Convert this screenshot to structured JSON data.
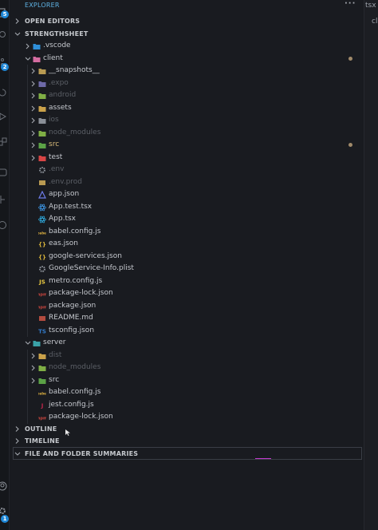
{
  "colors": {
    "background": "#191b20",
    "text": "#c5c8ce",
    "dim_text": "#5b5f66",
    "modified_dot": "#a08a6a",
    "error_dot": "#e0443e",
    "badge": "#1f88d8"
  },
  "activity_bar": {
    "badges": [
      "5",
      "2",
      "1"
    ]
  },
  "right_strip": {
    "tab_fragment": "tsx",
    "title_fragment": "cli"
  },
  "explorer": {
    "title": "EXPLORER",
    "more_icon": "ellipsis-icon"
  },
  "sections": {
    "open_editors": "OPEN EDITORS",
    "project": "STRENGTHSHEET",
    "outline": "OUTLINE",
    "timeline": "TIMELINE",
    "summaries": "FILE AND FOLDER SUMMARIES"
  },
  "tree": [
    {
      "name": ".vscode",
      "icon": "vscode-folder-icon",
      "depth": 0,
      "type": "folder",
      "dim": false
    },
    {
      "name": "client",
      "icon": "client-folder-icon",
      "depth": 0,
      "type": "folder",
      "expanded": true,
      "dim": false,
      "modified": true
    },
    {
      "name": "__snapshots__",
      "icon": "folder-icon",
      "depth": 1,
      "type": "folder",
      "dim": false
    },
    {
      "name": ".expo",
      "icon": "expo-folder-icon",
      "depth": 1,
      "type": "folder",
      "dim": true
    },
    {
      "name": "android",
      "icon": "android-folder-icon",
      "depth": 1,
      "type": "folder",
      "dim": true
    },
    {
      "name": "assets",
      "icon": "assets-folder-icon",
      "depth": 1,
      "type": "folder",
      "dim": false
    },
    {
      "name": "ios",
      "icon": "ios-folder-icon",
      "depth": 1,
      "type": "folder",
      "dim": true
    },
    {
      "name": "node_modules",
      "icon": "node-modules-folder-icon",
      "depth": 1,
      "type": "folder",
      "dim": true
    },
    {
      "name": "src",
      "icon": "src-folder-icon",
      "depth": 1,
      "type": "folder",
      "dim": false,
      "modified": true,
      "accent": true
    },
    {
      "name": "test",
      "icon": "test-folder-icon",
      "depth": 1,
      "type": "folder",
      "dim": false,
      "error": true
    },
    {
      "name": ".env",
      "icon": "gear-icon",
      "depth": 1,
      "type": "file",
      "dim": true
    },
    {
      "name": ".env.prod",
      "icon": "terminal-icon",
      "depth": 1,
      "type": "file",
      "dim": true
    },
    {
      "name": "app.json",
      "icon": "expo-app-icon",
      "depth": 1,
      "type": "file",
      "dim": false
    },
    {
      "name": "App.test.tsx",
      "icon": "react-test-icon",
      "depth": 1,
      "type": "file",
      "dim": false
    },
    {
      "name": "App.tsx",
      "icon": "react-icon",
      "depth": 1,
      "type": "file",
      "dim": false
    },
    {
      "name": "babel.config.js",
      "icon": "babel-icon",
      "depth": 1,
      "type": "file",
      "dim": false
    },
    {
      "name": "eas.json",
      "icon": "json-braces-icon",
      "depth": 1,
      "type": "file",
      "dim": false
    },
    {
      "name": "google-services.json",
      "icon": "json-braces-icon",
      "depth": 1,
      "type": "file",
      "dim": false
    },
    {
      "name": "GoogleService-Info.plist",
      "icon": "gear-icon",
      "depth": 1,
      "type": "file",
      "dim": false
    },
    {
      "name": "metro.config.js",
      "icon": "js-icon",
      "depth": 1,
      "type": "file",
      "dim": false
    },
    {
      "name": "package-lock.json",
      "icon": "npm-icon",
      "depth": 1,
      "type": "file",
      "dim": false
    },
    {
      "name": "package.json",
      "icon": "npm-icon",
      "depth": 1,
      "type": "file",
      "dim": false
    },
    {
      "name": "README.md",
      "icon": "readme-icon",
      "depth": 1,
      "type": "file",
      "dim": false
    },
    {
      "name": "tsconfig.json",
      "icon": "typescript-icon",
      "depth": 1,
      "type": "file",
      "dim": false
    },
    {
      "name": "server",
      "icon": "server-folder-icon",
      "depth": 0,
      "type": "folder",
      "expanded": true,
      "dim": false
    },
    {
      "name": "dist",
      "icon": "dist-folder-icon",
      "depth": 1,
      "type": "folder",
      "dim": true
    },
    {
      "name": "node_modules",
      "icon": "node-modules-folder-icon",
      "depth": 1,
      "type": "folder",
      "dim": true
    },
    {
      "name": "src",
      "icon": "src-folder-icon",
      "depth": 1,
      "type": "folder",
      "dim": false
    },
    {
      "name": "babel.config.js",
      "icon": "babel-icon",
      "depth": 1,
      "type": "file",
      "dim": false
    },
    {
      "name": "jest.config.js",
      "icon": "jest-icon",
      "depth": 1,
      "type": "file",
      "dim": false
    },
    {
      "name": "package-lock.json",
      "icon": "npm-icon",
      "depth": 1,
      "type": "file",
      "dim": false
    }
  ]
}
